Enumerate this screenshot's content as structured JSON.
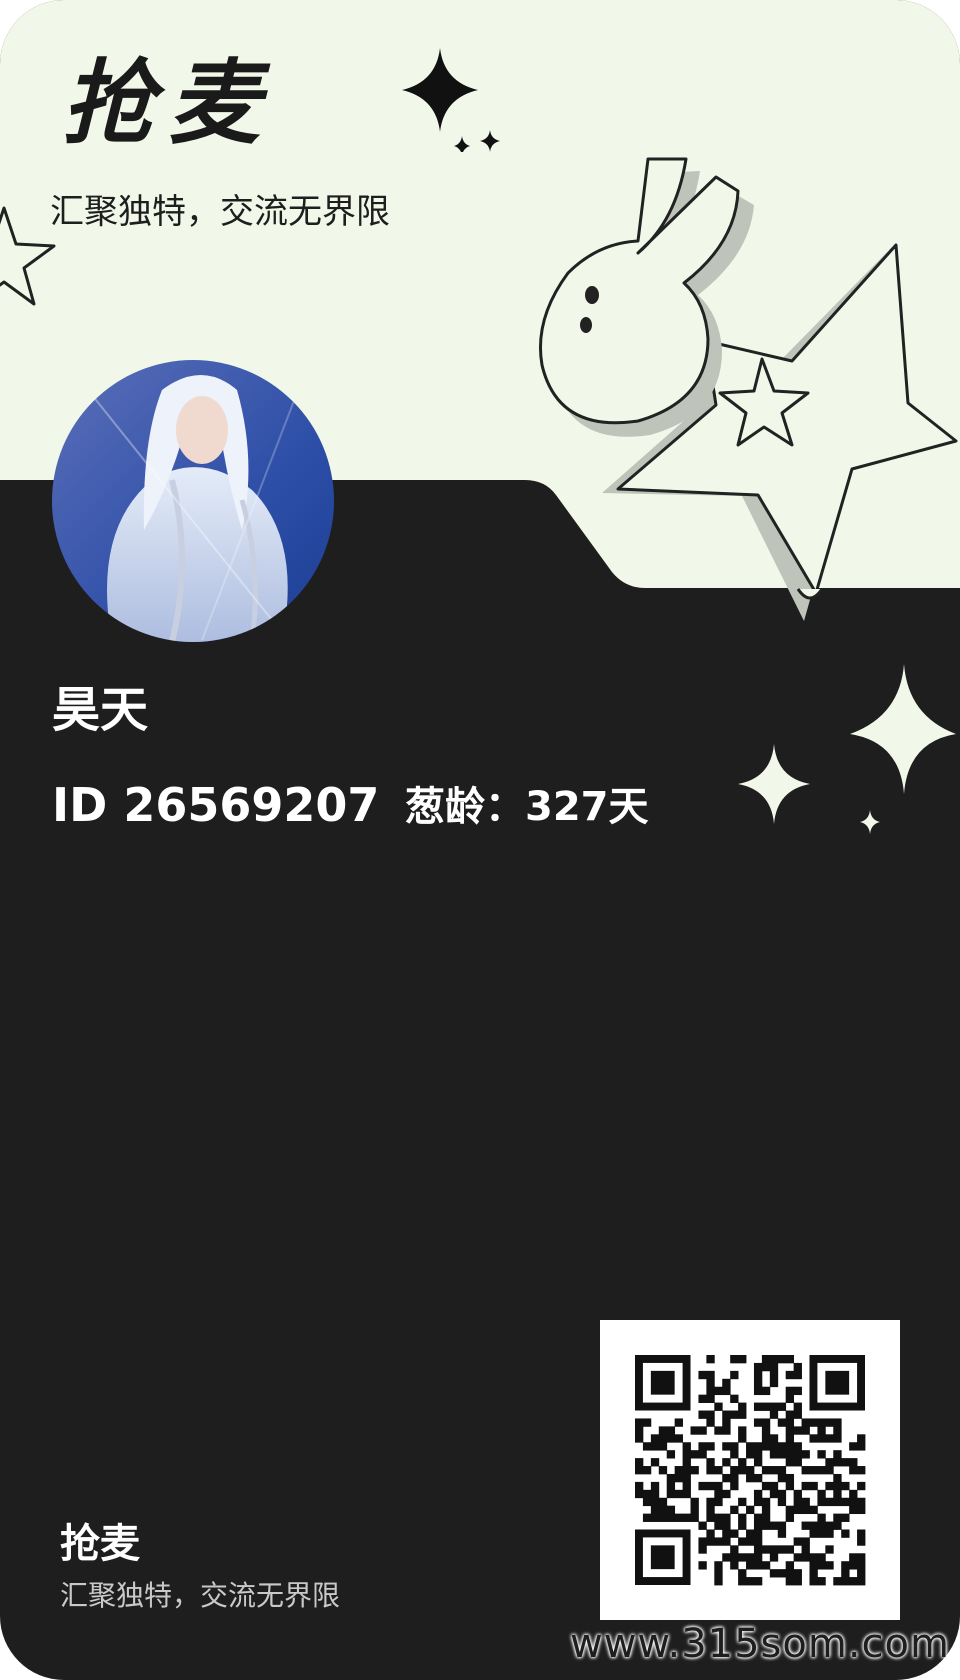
{
  "card": {
    "brand_title": "抢麦",
    "brand_subtitle": "汇聚独特，交流无界限"
  },
  "profile": {
    "avatar": "avatar-image",
    "username": "昊天",
    "id_text": "ID 26569207",
    "age_text": "葱龄：327天"
  },
  "footer": {
    "title": "抢麦",
    "subtitle": "汇聚独特，交流无界限",
    "qr_code": "qr-code"
  },
  "watermark": "www.315som.com",
  "colors": {
    "top_background": "#f1f8e9",
    "bottom_background": "#1e1e1e",
    "text_light": "#ffffff",
    "text_dark": "#1a1a1a"
  },
  "icons": [
    "sparkle-icon",
    "star-icon",
    "rabbit-icon",
    "qr-code"
  ]
}
